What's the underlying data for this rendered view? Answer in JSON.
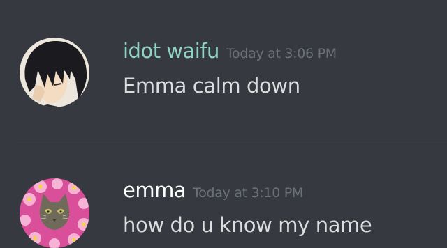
{
  "colors": {
    "background": "#36393f",
    "username_1": "#8fd3c2",
    "username_2": "#ffffff",
    "timestamp": "#6c7077",
    "message_text": "#dcddde"
  },
  "messages": [
    {
      "avatar_icon": "anime-boy-avatar-icon",
      "username": "idot waifu",
      "timestamp": "Today at 3:06 PM",
      "content": "Emma calm down"
    },
    {
      "avatar_icon": "cat-flowers-avatar-icon",
      "username": "emma",
      "timestamp": "Today at 3:10 PM",
      "content": "how do u know my name"
    }
  ]
}
